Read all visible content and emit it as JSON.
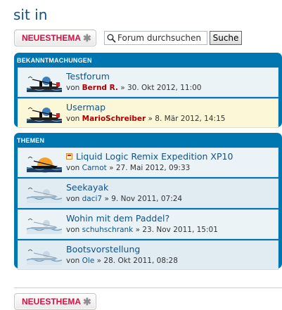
{
  "page": {
    "title": "sit in"
  },
  "toolbar": {
    "new_topic_prefix": "NEUES",
    "new_topic_suffix": "THEMA",
    "plus_glyph": "✱",
    "search_placeholder": "Forum durchsuchen",
    "search_button": "Suche"
  },
  "announcements": {
    "header": "BEKANNTMACHUNGEN",
    "rows": [
      {
        "title": "Testforum",
        "by": "von",
        "author": "Bernd R.",
        "sep": "»",
        "date": "30. Okt 2012, 11:00"
      },
      {
        "title": "Usermap",
        "by": "von",
        "author": "MarioSchreiber",
        "sep": "»",
        "date": "8. Mär 2012, 14:15"
      }
    ]
  },
  "topics": {
    "header": "THEMEN",
    "rows": [
      {
        "title": "Liquid Logic Remix Expedition XP10",
        "by": "von",
        "author": "Carnot",
        "sep": "»",
        "date": "27. Mai 2012, 09:33"
      },
      {
        "title": "Seekayak",
        "by": "von",
        "author": "daci7",
        "sep": "»",
        "date": "9. Nov 2011, 07:24"
      },
      {
        "title": "Wohin mit dem Paddel?",
        "by": "von",
        "author": "schuhschrank",
        "sep": "»",
        "date": "23. Nov 2011, 15:01"
      },
      {
        "title": "Bootsvorstellung",
        "by": "von",
        "author": "Ole",
        "sep": "»",
        "date": "28. Okt 2011, 08:28"
      }
    ]
  },
  "colors": {
    "accent_blue": "#0076b1",
    "link_blue": "#105289",
    "new_topic_red": "#d31141",
    "moderator_red": "#aa0000",
    "announcement_highlight": "#fcf7d6"
  },
  "icons": {
    "forum_read": "boat-icon",
    "forum_hot": "sunset-boat-icon",
    "forum_faded": "faded-boat-icon",
    "sticky": "sticky-icon",
    "search": "search-icon"
  }
}
